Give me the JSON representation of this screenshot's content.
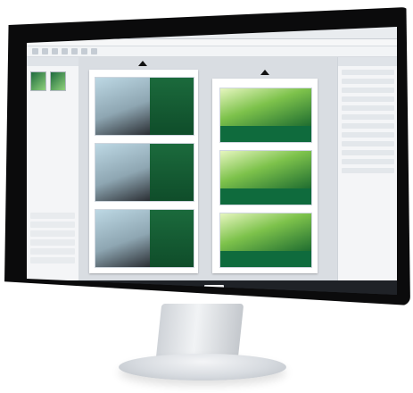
{
  "scene": {
    "caption": ""
  },
  "app": {
    "title": "",
    "menu": [],
    "left_panel_header": "",
    "right_panel_header": "",
    "status": {
      "left": "",
      "page_label": ""
    }
  },
  "colors": {
    "bezel": "#0b0b0c",
    "workspace": "#d9dde2",
    "green": "#0f6b3d"
  }
}
